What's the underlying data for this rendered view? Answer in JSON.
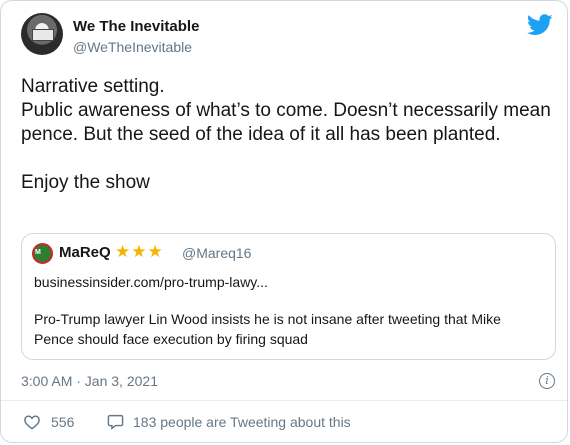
{
  "author": {
    "name": "We The Inevitable",
    "handle": "@WeTheInevitable"
  },
  "tweet": {
    "lines": [
      "Narrative setting.",
      "Public awareness of what’s to come. Doesn’t necessarily mean pence. But the seed of the idea of it all has been planted.",
      "Enjoy the show"
    ]
  },
  "quoted": {
    "name": "MaReQ",
    "stars": "★★★",
    "handle": "@Mareq16",
    "avatar_text": "M",
    "link": "businessinsider.com/pro-trump-lawy...",
    "body": "Pro-Trump lawyer Lin Wood insists he is not insane after tweeting that Mike Pence should face execution by firing squad"
  },
  "meta": {
    "timestamp": "3:00 AM · Jan 3, 2021",
    "info_glyph": "i"
  },
  "actions": {
    "likes": "556",
    "talking": "183 people are Tweeting about this"
  },
  "colors": {
    "accent": "#1da1f2",
    "secondary_text": "#657786",
    "border": "#cfd9de",
    "star": "#f4b400"
  },
  "icons": {
    "logo": "twitter-bird-icon",
    "info": "info-icon",
    "like": "heart-icon",
    "reply": "speech-bubble-icon"
  }
}
